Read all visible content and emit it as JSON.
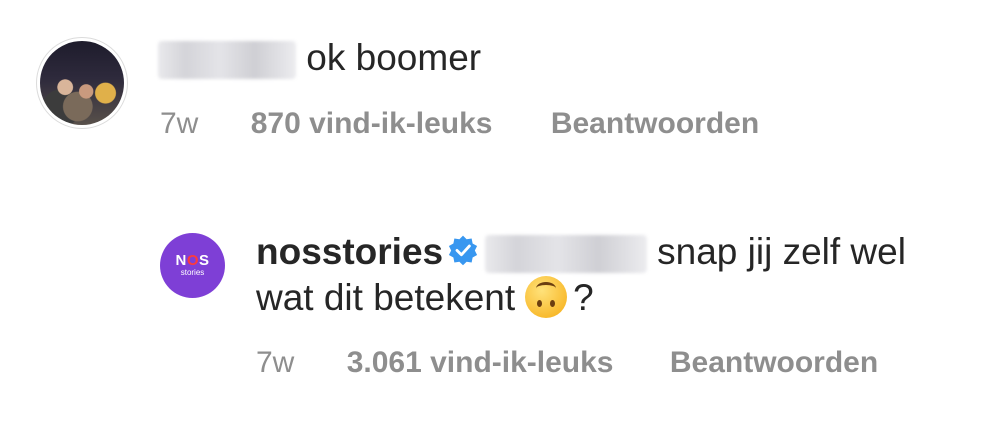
{
  "comments": [
    {
      "avatar": "user-photo-avatar",
      "username_redacted": true,
      "text": "ok boomer",
      "time": "7w",
      "likes": "870 vind-ik-leuks",
      "reply_label": "Beantwoorden"
    },
    {
      "avatar": "nos-stories-logo",
      "avatar_logo_text": "NOS",
      "avatar_logo_sub": "stories",
      "username": "nosstories",
      "verified": true,
      "mention_redacted": true,
      "text_part1": "snap jij zelf wel",
      "text_part2": "wat dit betekent",
      "emoji": "upside-down-face",
      "text_end": "?",
      "time": "7w",
      "likes": "3.061 vind-ik-leuks",
      "reply_label": "Beantwoorden"
    }
  ],
  "colors": {
    "text": "#262626",
    "meta": "#8e8e8e",
    "verified": "#3897f0",
    "nos_purple": "#7e3fd6"
  }
}
